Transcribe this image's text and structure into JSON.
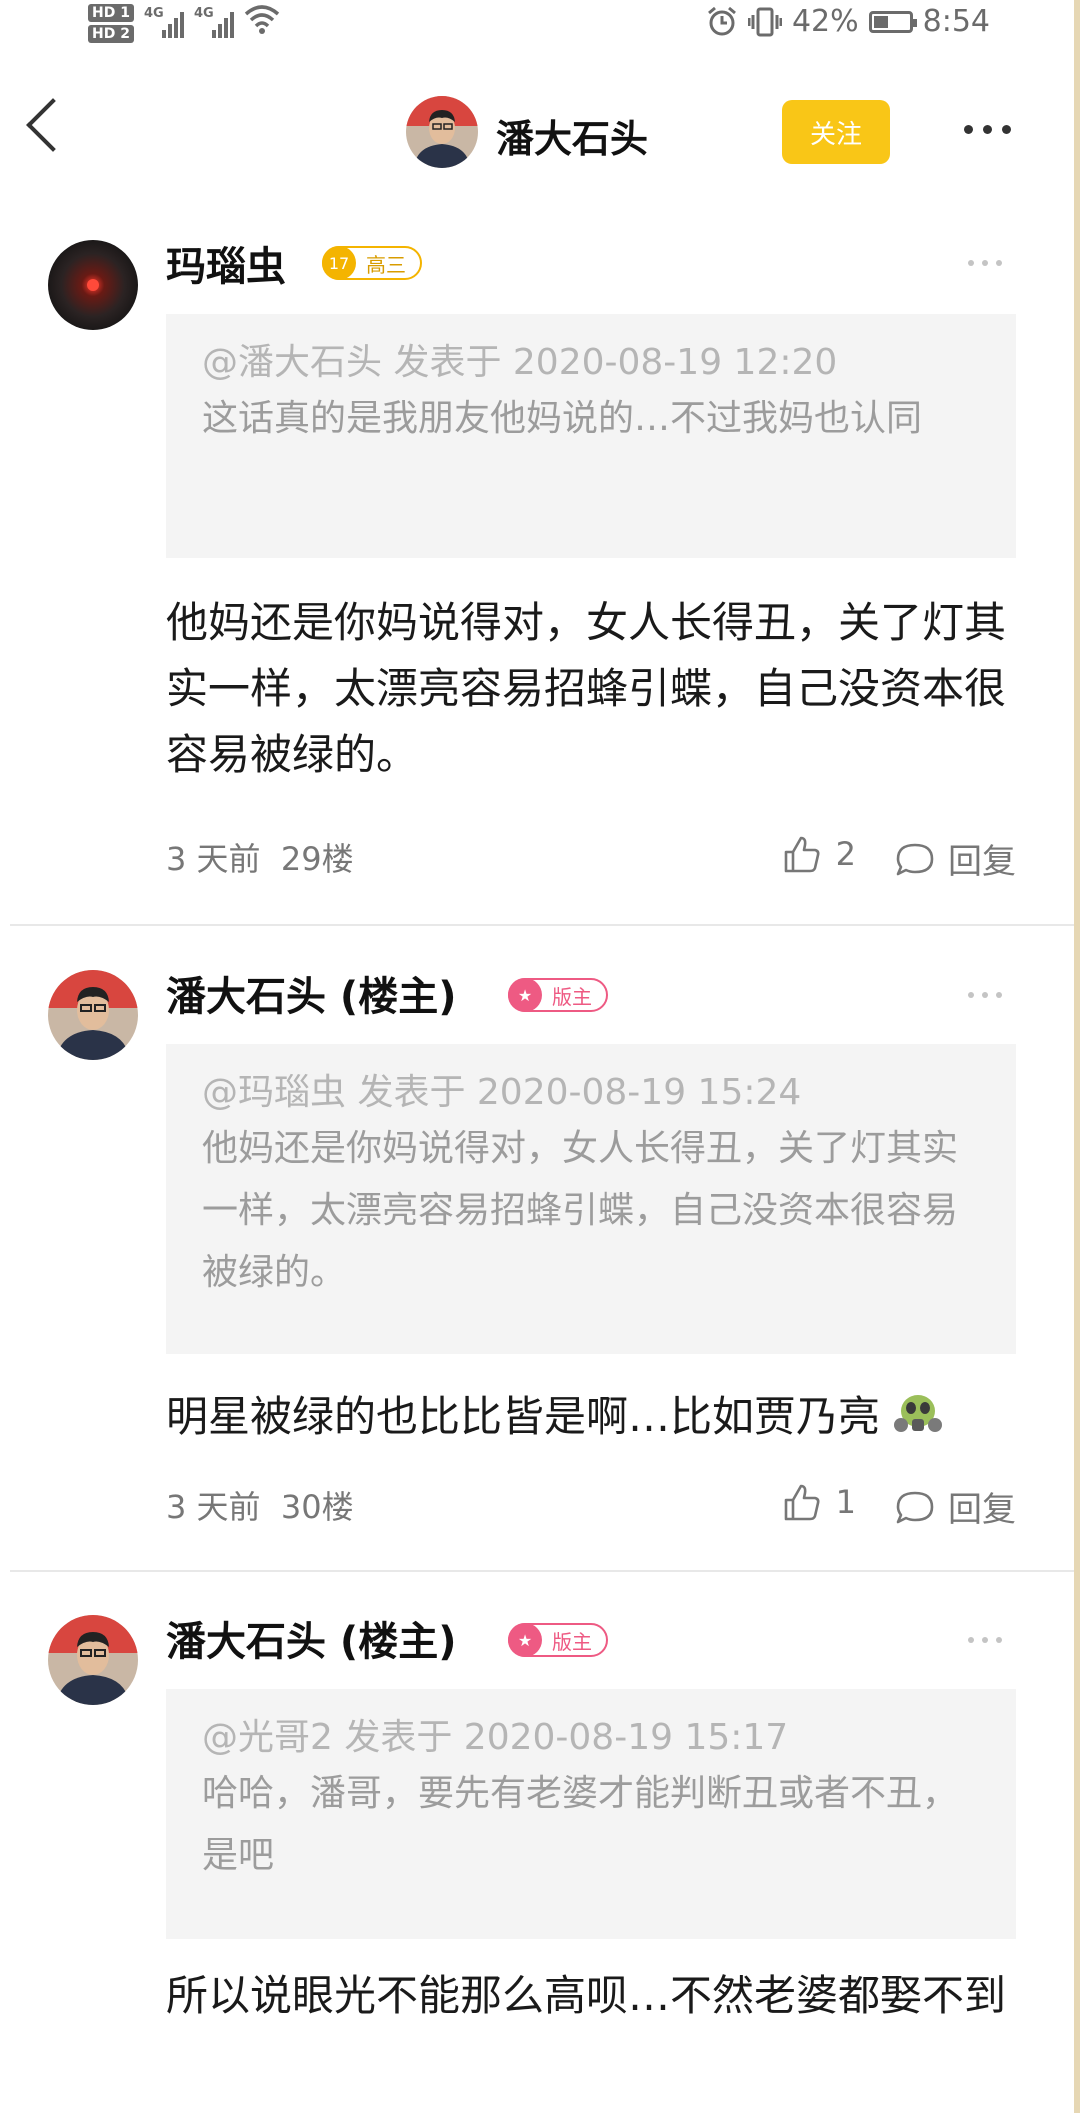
{
  "status_bar": {
    "hd1": "HD 1",
    "hd2": "HD 2",
    "net1": "4G",
    "net2": "4G",
    "battery": "42%",
    "battery_level": 0.42,
    "time": "8:54",
    "alarm_icon": "alarm-icon",
    "vibrate_icon": "vibrate-icon",
    "wifi_icon": "wifi-icon"
  },
  "header": {
    "title": "潘大石头",
    "follow": "关注",
    "follow_color": "#f9c617",
    "back_icon": "chevron-left-icon",
    "more_icon": "more-dots-icon"
  },
  "posts": [
    {
      "username": "玛瑙虫",
      "badge_level": "17",
      "badge_text": "高三",
      "quote_meta": "@潘大石头 发表于 2020-08-19 12:20",
      "quote_text": "这话真的是我朋友他妈说的…不过我妈也认同",
      "content": "他妈还是你妈说得对，女人长得丑，关了灯其实一样，太漂亮容易招蜂引蝶，自己没资本很容易被绿的。",
      "time": "3 天前",
      "floor": "29楼",
      "likes": "2",
      "reply": "回复"
    },
    {
      "username": "潘大石头 (楼主)",
      "badge_text": "版主",
      "quote_meta": "@玛瑙虫 发表于 2020-08-19 15:24",
      "quote_text": "他妈还是你妈说得对，女人长得丑，关了灯其实一样，太漂亮容易招蜂引蝶，自己没资本很容易被绿的。",
      "content": "明星被绿的也比比皆是啊…比如贾乃亮",
      "emoji": "gas-mask-emoji",
      "time": "3 天前",
      "floor": "30楼",
      "likes": "1",
      "reply": "回复"
    },
    {
      "username": "潘大石头 (楼主)",
      "badge_text": "版主",
      "quote_meta": "@光哥2 发表于 2020-08-19 15:17",
      "quote_text": "哈哈，潘哥，要先有老婆才能判断丑或者不丑，是吧",
      "content": "所以说眼光不能那么高呗…不然老婆都娶不到"
    }
  ]
}
